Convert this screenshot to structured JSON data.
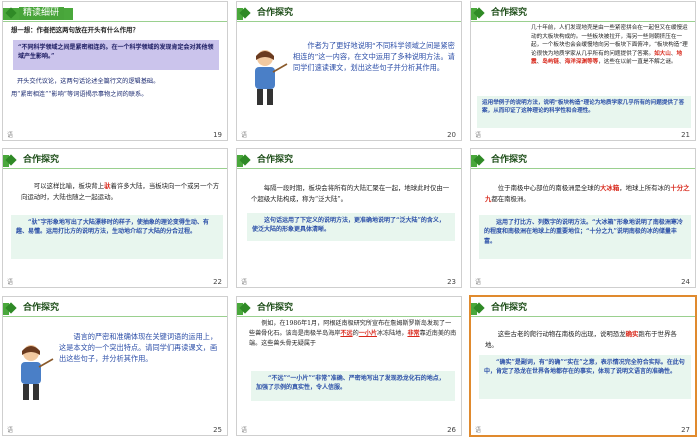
{
  "slides": [
    {
      "num": "19",
      "title": "精读细研",
      "footer": "语",
      "question": "想一想：作者把这两句放在开头有什么作用？",
      "quote": "“不同科学领域之间是紧密相连的。在一个科学领域的发现肯定会对其他领域产生影响。”",
      "answer1": "开头交代议论，这两句话论述全篇行文的逻辑基础。",
      "answer2": "用“紧密相连”“影响”等词语揭示事物之间的联系。"
    },
    {
      "num": "20",
      "title": "合作探究",
      "footer": "语",
      "speech": "作者为了更好地说明“不同科学领域之间是紧密相连的”这一内容，在文中运用了多种说明方法。请同学们速读课文，划出这些句子并分析其作用。"
    },
    {
      "num": "21",
      "title": "合作探究",
      "footer": "语",
      "p1": "几十年前，人们发现地壳是由一些紧密拼合在一起但又在缓慢运动的大板块构成的。一些板块被拉开，海另一些则朝挤压在一起，一个板块也会会缓慢地向另一板块下面俯冲，“板块构造”理论很快为地质学家从几乎所有的问题提供了答案。",
      "red1": "如大山",
      "red2": "地震",
      "red3": "岛屿链",
      "red4": "海洋深渊等等",
      "p1end": "，这些在以前一直是不解之谜。",
      "box": "运用举例子的说明方法，说明“板块构造”理论为地质学家几乎所有的问题提供了答案，从而印证了这种理论的科学性和合理性。"
    },
    {
      "num": "22",
      "title": "合作探究",
      "footer": "语",
      "p1a": "可以这样比喻，板块背上",
      "red1": "驮",
      "p1b": "着许多大陆，当板块向一个或另一个方向运动时，大陆也随之一起运动。",
      "box": "“驮”字形象地写出了大陆漂移时的样子，使抽象的理论变得生动、有趣、易懂。运用打比方的说明方法，生动地介绍了大陆的分合过程。"
    },
    {
      "num": "23",
      "title": "合作探究",
      "footer": "语",
      "p1": "每隔一段时期，板块会将所有的大陆汇聚在一起，地球此时仅由一个超级大陆构成，称为“泛大陆”。",
      "box": "这句话运用了下定义的说明方法，更准确地说明了“泛大陆”的含义，使泛大陆的形象更具体清晰。"
    },
    {
      "num": "24",
      "title": "合作探究",
      "footer": "语",
      "p1a": "位于南极中心部位的南极洲是全球的",
      "red1": "大冰箱",
      "p1b": "，地球上所有冰的",
      "red2": "十分之九",
      "p1c": "都在南极洲。",
      "box": "运用了打比方、列数字的说明方法。“大冰箱”形象地说明了南极洲寒冷的程度和南极洲在地球上的重要地位；“十分之九”说明南极的冰的储量丰富。"
    },
    {
      "num": "25",
      "title": "合作探究",
      "footer": "语",
      "speech": "语言的严密和准确体现在关键词语的运用上，这是本文的一个突出特点。请同学们再读课文，画出这些句子，并分析其作用。"
    },
    {
      "num": "26",
      "title": "合作探究",
      "footer": "语",
      "p1a": "例如，在1986年1月，阿根廷南极研究所宣布在詹姆斯罗斯岛发现了一些兽骨化石。该岛是南极半岛海岸",
      "red1": "不远",
      "p1b": "的",
      "red2": "一小片",
      "p1c": "冰冻陆地，",
      "red3": "非常",
      "p1d": "靠近南美的南端。这些兽头骨无疑属于",
      "box": "“不远”“一小片”“非常”准确、严密地写出了发现恐龙化石的地点，加强了示例的真实性，令人信服。"
    },
    {
      "num": "27",
      "title": "合作探究",
      "footer": "语",
      "p1a": "这些古老的爬行动物在南极的出现，说明恐龙",
      "red1": "确实",
      "p1b": "跑布于世界各地。",
      "box": "“确实”是副词，有“的确”“实在”之意，表示情况完全符合实际。在此句中，肯定了恐龙在世界各地都存在的事实，体现了说明文语言的准确性。"
    }
  ],
  "colors": {
    "header_green": "#48a53a",
    "highlight_red": "#d8291c",
    "note_blue": "#2c50a8",
    "selection_orange": "#e08a2e"
  }
}
